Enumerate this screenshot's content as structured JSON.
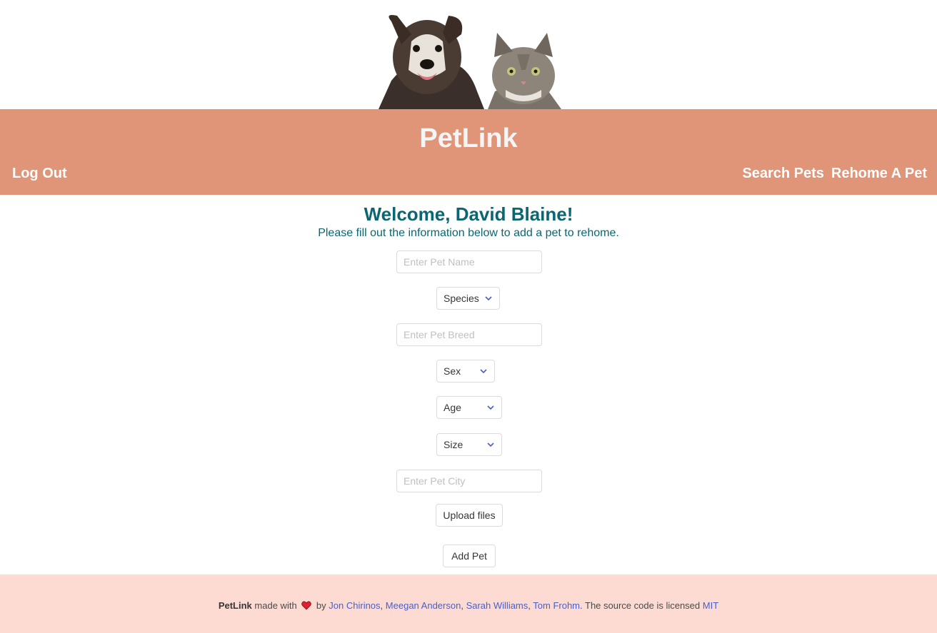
{
  "header": {
    "brand": "PetLink",
    "nav_left": {
      "logout": "Log Out"
    },
    "nav_right": {
      "search": "Search Pets",
      "rehome": "Rehome A Pet"
    },
    "accent_color": "#e09478"
  },
  "main": {
    "welcome": "Welcome, David Blaine!",
    "subtitle": "Please fill out the information below to add a pet to rehome.",
    "form": {
      "pet_name_placeholder": "Enter Pet Name",
      "species_label": "Species",
      "pet_breed_placeholder": "Enter Pet Breed",
      "sex_label": "Sex",
      "age_label": "Age",
      "size_label": "Size",
      "pet_city_placeholder": "Enter Pet City",
      "upload_label": "Upload files",
      "submit_label": "Add Pet"
    },
    "heading_color": "#0b6670"
  },
  "footer": {
    "brand": "PetLink",
    "made_with": "made with",
    "by": "by",
    "authors": [
      "Jon Chirinos",
      "Meegan Anderson",
      "Sarah Williams",
      "Tom Frohm"
    ],
    "separator": ",",
    "license_text": ". The source code is licensed",
    "license_link": "MIT",
    "background": "#fddbd2"
  }
}
